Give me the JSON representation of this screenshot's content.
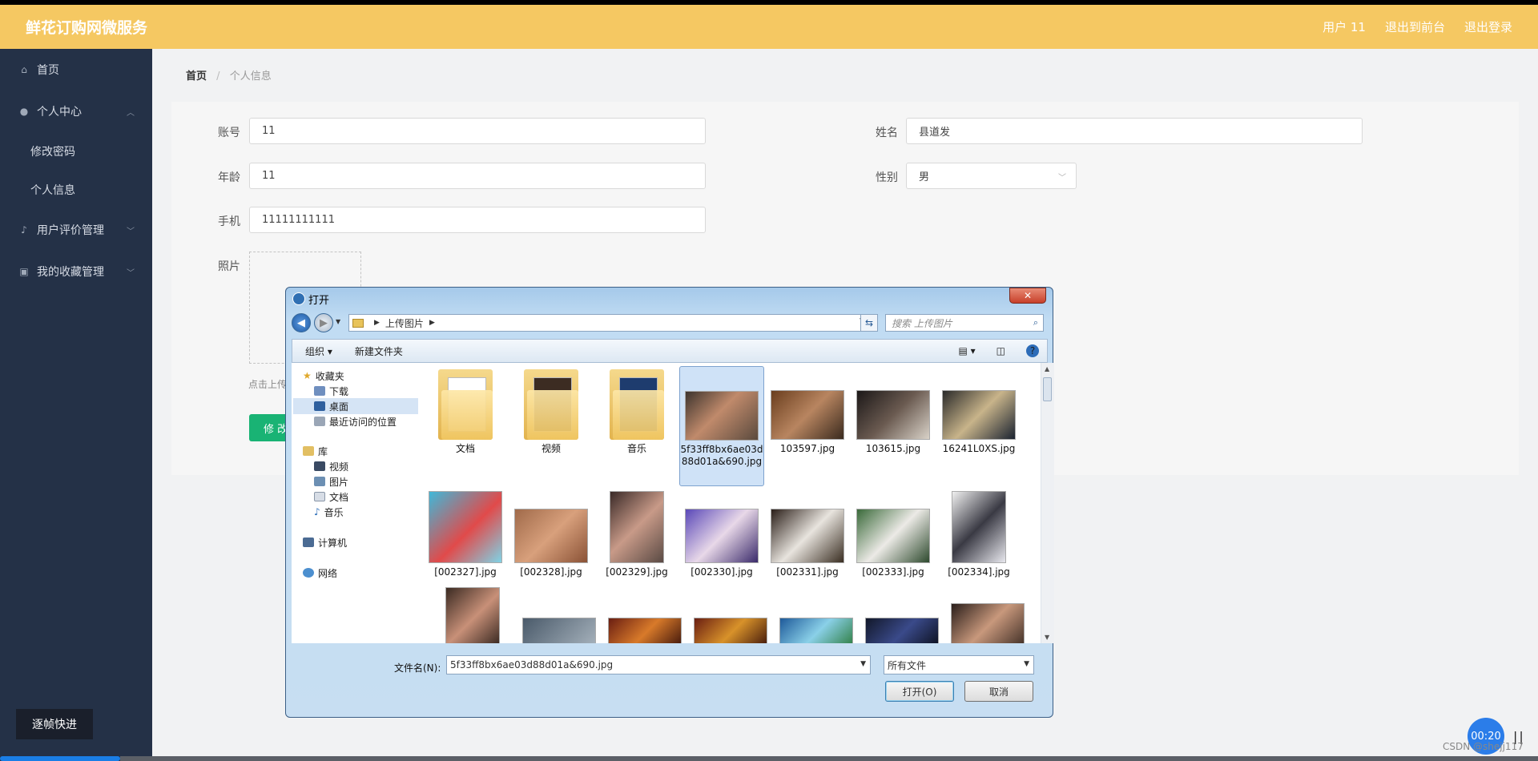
{
  "header": {
    "brand": "鲜花订购网微服务",
    "nav": [
      "用户 11",
      "退出到前台",
      "退出登录"
    ]
  },
  "sidebar": {
    "items": [
      {
        "label": "首页",
        "icon": "home-icon"
      },
      {
        "label": "个人中心",
        "icon": "user-icon",
        "expanded": true
      },
      {
        "label": "用户评价管理",
        "icon": "microphone-icon"
      },
      {
        "label": "我的收藏管理",
        "icon": "collection-icon"
      }
    ],
    "subitems": [
      "修改密码",
      "个人信息"
    ],
    "frame_button": "逐帧快进"
  },
  "breadcrumb": {
    "home": "首页",
    "sep": "/",
    "current": "个人信息"
  },
  "form": {
    "account_label": "账号",
    "account_value": "11",
    "name_label": "姓名",
    "name_value": "县道发",
    "age_label": "年龄",
    "age_value": "11",
    "gender_label": "性别",
    "gender_value": "男",
    "phone_label": "手机",
    "phone_value": "11111111111",
    "photo_label": "照片",
    "upload_tip": "点击上传",
    "submit": "修 改"
  },
  "dialog": {
    "title": "打开",
    "close": "✕",
    "address": "上传图片",
    "search_placeholder": "搜索 上传图片",
    "cmd": [
      "组织 ▾",
      "新建文件夹"
    ],
    "nav": {
      "favorites": "收藏夹",
      "fav_items": [
        "下载",
        "桌面",
        "最近访问的位置"
      ],
      "library": "库",
      "lib_items": [
        "视频",
        "图片",
        "文档",
        "音乐"
      ],
      "computer": "计算机",
      "network": "网络"
    },
    "folders": [
      "文档",
      "视频",
      "音乐"
    ],
    "files_row1": [
      "5f33ff8bx6ae03d88d01a&690.jpg",
      "103597.jpg",
      "103615.jpg",
      "16241L0XS.jpg"
    ],
    "files_row2": [
      "[002327].jpg",
      "[002328].jpg",
      "[002329].jpg",
      "[002330].jpg",
      "[002331].jpg",
      "[002333].jpg",
      "[002334].jpg"
    ],
    "filename_label": "文件名(N):",
    "filename_value": "5f33ff8bx6ae03d88d01a&690.jpg",
    "filetype_value": "所有文件",
    "open_button": "打开(O)",
    "cancel_button": "取消"
  },
  "recorder": {
    "timer": "00:20",
    "watermark": "CSDN @shejj117"
  },
  "colors": {
    "header": "#f5c862",
    "sidebar": "#243147",
    "accent": "#19b374"
  }
}
